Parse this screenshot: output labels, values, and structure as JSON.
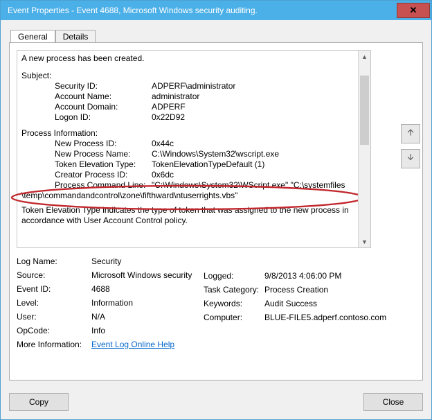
{
  "window": {
    "title": "Event Properties - Event 4688, Microsoft Windows security auditing."
  },
  "tabs": {
    "general": "General",
    "details": "Details"
  },
  "desc": {
    "heading": "A new process has been created.",
    "subject_label": "Subject:",
    "security_id_label": "Security ID:",
    "security_id": "ADPERF\\administrator",
    "account_name_label": "Account Name:",
    "account_name": "administrator",
    "account_domain_label": "Account Domain:",
    "account_domain": "ADPERF",
    "logon_id_label": "Logon ID:",
    "logon_id": "0x22D92",
    "proc_info_label": "Process Information:",
    "new_pid_label": "New Process ID:",
    "new_pid": "0x44c",
    "new_pname_label": "New Process Name:",
    "new_pname": "C:\\Windows\\System32\\wscript.exe",
    "tet_label": "Token Elevation Type:",
    "tet": "TokenElevationTypeDefault (1)",
    "creator_pid_label": "Creator Process ID:",
    "creator_pid": "0x6dc",
    "cmdline_label": "Process Command Line:",
    "cmdline_a": "\"C:\\Windows\\System32\\WScript.exe\" \"C:\\systemfiles",
    "cmdline_b": "\\temp\\commandandcontrol\\zone\\fifthward\\ntuserrights.vbs\"",
    "explain": "Token Elevation Type indicates the type of token that was assigned to the new process in accordance with User Account Control policy."
  },
  "details": {
    "left": {
      "logname_l": "Log Name:",
      "logname_v": "Security",
      "source_l": "Source:",
      "source_v": "Microsoft Windows security",
      "eventid_l": "Event ID:",
      "eventid_v": "4688",
      "level_l": "Level:",
      "level_v": "Information",
      "user_l": "User:",
      "user_v": "N/A",
      "opcode_l": "OpCode:",
      "opcode_v": "Info",
      "moreinfo_l": "More Information:",
      "moreinfo_link": "Event Log Online Help"
    },
    "right": {
      "logged_l": "Logged:",
      "logged_v": "9/8/2013 4:06:00 PM",
      "taskcat_l": "Task Category:",
      "taskcat_v": "Process Creation",
      "keywords_l": "Keywords:",
      "keywords_v": "Audit Success",
      "computer_l": "Computer:",
      "computer_v": "BLUE-FILE5.adperf.contoso.com"
    }
  },
  "buttons": {
    "copy": "Copy",
    "close": "Close"
  }
}
